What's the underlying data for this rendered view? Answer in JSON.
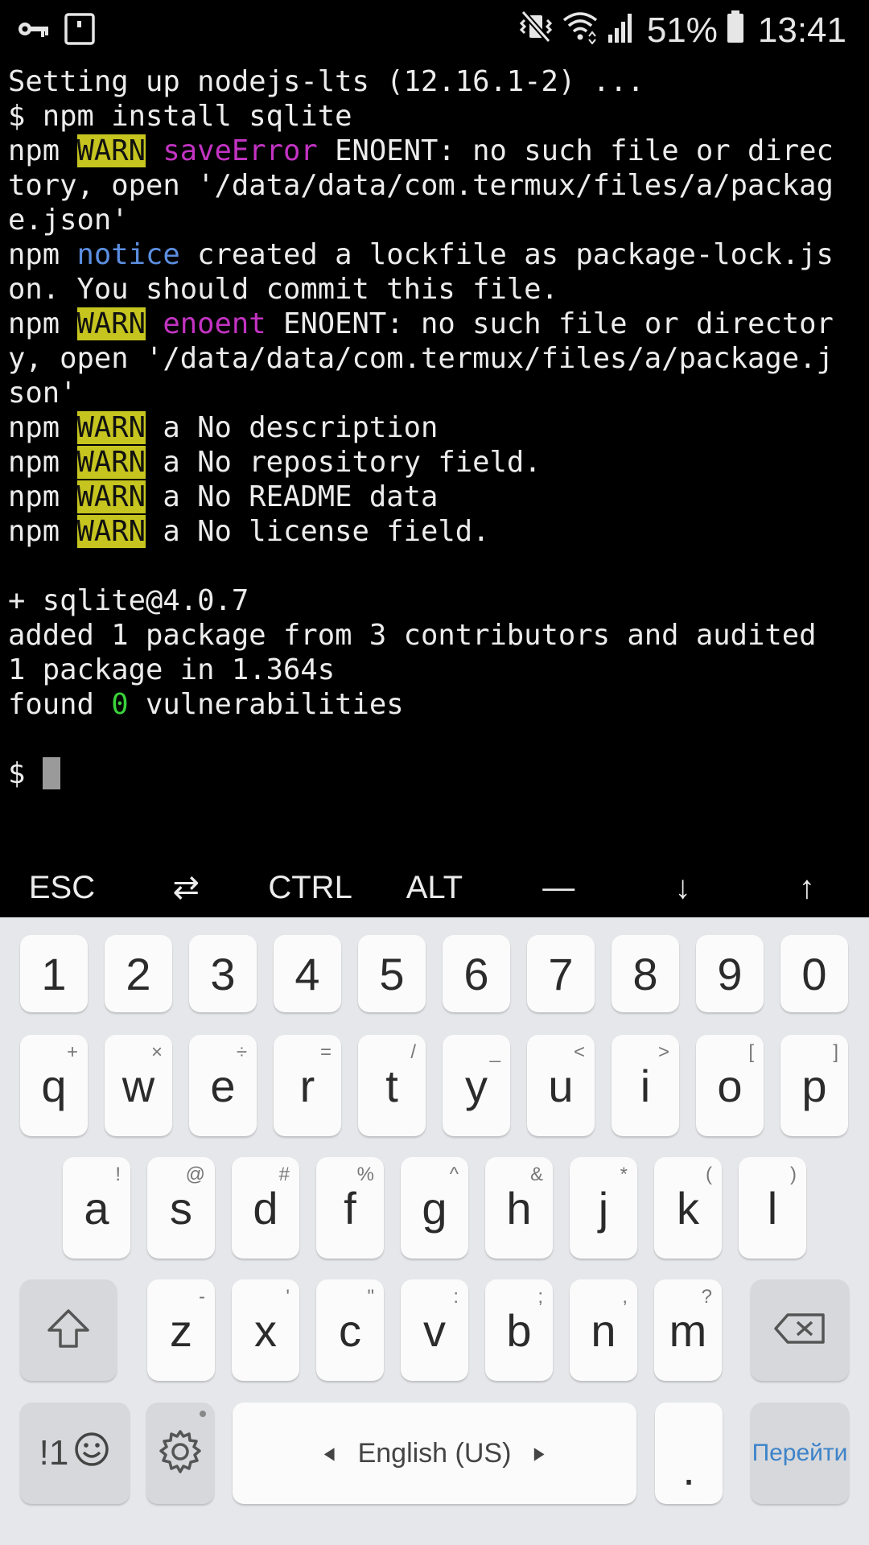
{
  "status_bar": {
    "battery_percent": "51%",
    "time": "13:41",
    "icons": [
      "key-icon",
      "screenshot-icon",
      "mute-vibrate-icon",
      "wifi-icon",
      "signal-icon",
      "battery-icon"
    ]
  },
  "terminal": {
    "lines": [
      [
        {
          "t": "Setting up nodejs-lts (12.16.1-2) ..."
        }
      ],
      [
        {
          "t": "$ npm install sqlite"
        }
      ],
      [
        {
          "t": "npm "
        },
        {
          "t": "WARN",
          "c": "warn"
        },
        {
          "t": " "
        },
        {
          "t": "saveError",
          "c": "magenta"
        },
        {
          "t": " ENOENT: no such file or direc"
        }
      ],
      [
        {
          "t": "tory, open '/data/data/com.termux/files/a/packag"
        }
      ],
      [
        {
          "t": "e.json'"
        }
      ],
      [
        {
          "t": "npm "
        },
        {
          "t": "notice",
          "c": "blue"
        },
        {
          "t": " created a lockfile as package-lock.js"
        }
      ],
      [
        {
          "t": "on. You should commit this file."
        }
      ],
      [
        {
          "t": "npm "
        },
        {
          "t": "WARN",
          "c": "warn"
        },
        {
          "t": " "
        },
        {
          "t": "enoent",
          "c": "magenta"
        },
        {
          "t": " ENOENT: no such file or director"
        }
      ],
      [
        {
          "t": "y, open '/data/data/com.termux/files/a/package.j"
        }
      ],
      [
        {
          "t": "son'"
        }
      ],
      [
        {
          "t": "npm "
        },
        {
          "t": "WARN",
          "c": "warn"
        },
        {
          "t": " a No description"
        }
      ],
      [
        {
          "t": "npm "
        },
        {
          "t": "WARN",
          "c": "warn"
        },
        {
          "t": " a No repository field."
        }
      ],
      [
        {
          "t": "npm "
        },
        {
          "t": "WARN",
          "c": "warn"
        },
        {
          "t": " a No README data"
        }
      ],
      [
        {
          "t": "npm "
        },
        {
          "t": "WARN",
          "c": "warn"
        },
        {
          "t": " a No license field."
        }
      ],
      [],
      [
        {
          "t": "+ sqlite@4.0.7"
        }
      ],
      [
        {
          "t": "added 1 package from 3 contributors and audited"
        }
      ],
      [
        {
          "t": "1 package in 1.364s"
        }
      ],
      [
        {
          "t": "found "
        },
        {
          "t": "0",
          "c": "green"
        },
        {
          "t": " vulnerabilities"
        }
      ],
      [],
      [
        {
          "t": "$ "
        },
        {
          "cursor": true
        }
      ]
    ],
    "colors": {
      "warn_bg": "#c6c41f",
      "magenta": "#c233c2",
      "blue": "#5c8ee0",
      "green": "#3ad33a"
    }
  },
  "extra_keys": [
    {
      "label": "ESC",
      "name": "esc-key"
    },
    {
      "label": "⇄",
      "name": "tab-key"
    },
    {
      "label": "CTRL",
      "name": "ctrl-key"
    },
    {
      "label": "ALT",
      "name": "alt-key"
    },
    {
      "label": "—",
      "name": "dash-key"
    },
    {
      "label": "↓",
      "name": "arrow-down-key"
    },
    {
      "label": "↑",
      "name": "arrow-up-key"
    }
  ],
  "keyboard": {
    "row_numbers": [
      {
        "k": "1"
      },
      {
        "k": "2"
      },
      {
        "k": "3"
      },
      {
        "k": "4"
      },
      {
        "k": "5"
      },
      {
        "k": "6"
      },
      {
        "k": "7"
      },
      {
        "k": "8"
      },
      {
        "k": "9"
      },
      {
        "k": "0"
      }
    ],
    "row_top": [
      {
        "k": "q",
        "h": "+"
      },
      {
        "k": "w",
        "h": "×"
      },
      {
        "k": "e",
        "h": "÷"
      },
      {
        "k": "r",
        "h": "="
      },
      {
        "k": "t",
        "h": "/"
      },
      {
        "k": "y",
        "h": "_"
      },
      {
        "k": "u",
        "h": "<"
      },
      {
        "k": "i",
        "h": ">"
      },
      {
        "k": "o",
        "h": "["
      },
      {
        "k": "p",
        "h": "]"
      }
    ],
    "row_middle": [
      {
        "k": "a",
        "h": "!"
      },
      {
        "k": "s",
        "h": "@"
      },
      {
        "k": "d",
        "h": "#"
      },
      {
        "k": "f",
        "h": "%"
      },
      {
        "k": "g",
        "h": "^"
      },
      {
        "k": "h",
        "h": "&"
      },
      {
        "k": "j",
        "h": "*"
      },
      {
        "k": "k",
        "h": "("
      },
      {
        "k": "l",
        "h": ")"
      }
    ],
    "row_bottom": [
      {
        "k": "z",
        "h": "-"
      },
      {
        "k": "x",
        "h": "'"
      },
      {
        "k": "c",
        "h": "\""
      },
      {
        "k": "v",
        "h": ":"
      },
      {
        "k": "b",
        "h": ";"
      },
      {
        "k": "n",
        "h": ","
      },
      {
        "k": "m",
        "h": "?"
      }
    ],
    "symbols_label": "!1",
    "space_label": "English (US)",
    "period_label": ".",
    "go_label": "Перейти"
  }
}
